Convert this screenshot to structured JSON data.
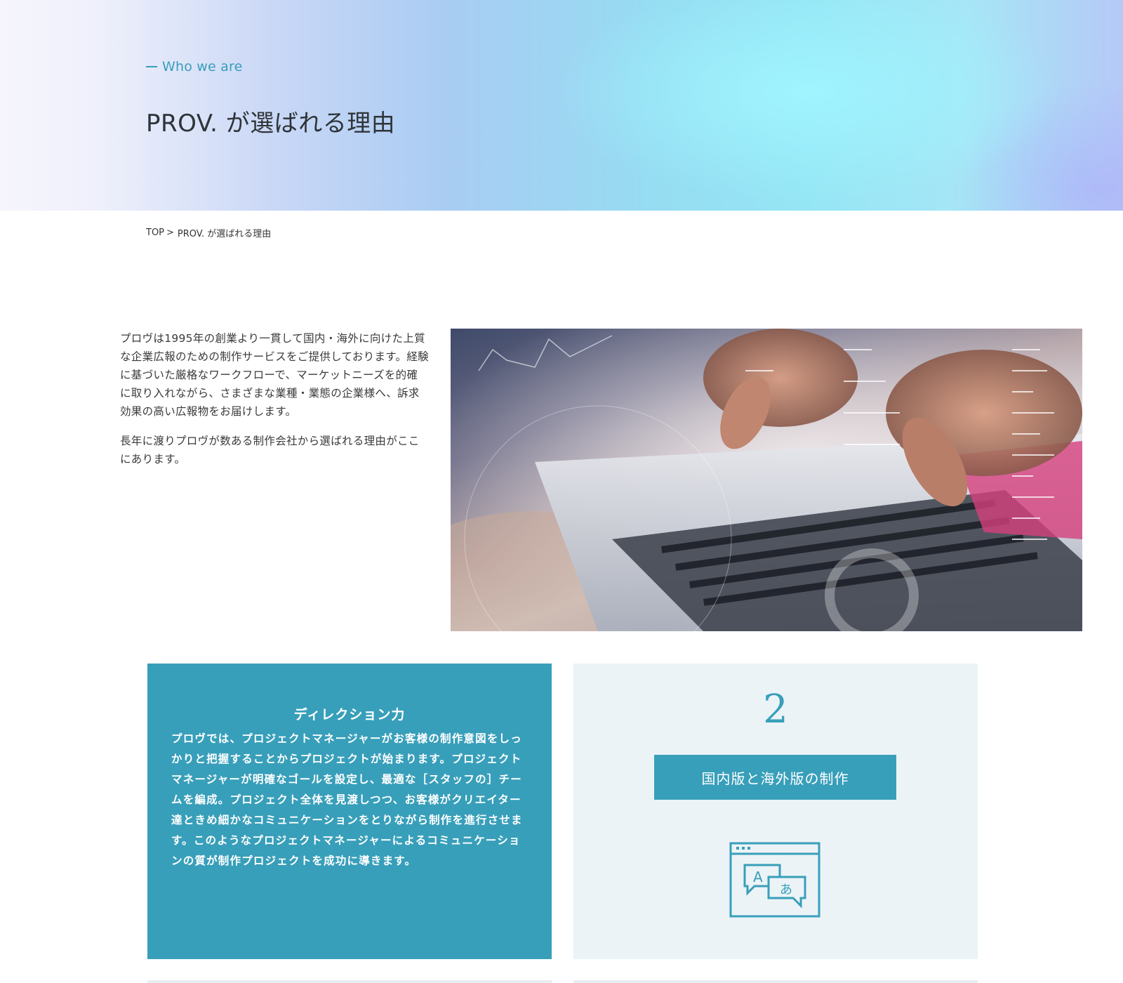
{
  "hero": {
    "eyebrow": "Who we are",
    "title": "PROV. が選ばれる理由"
  },
  "breadcrumb": {
    "home": "TOP",
    "separator": ">",
    "current": "PROV. が選ばれる理由"
  },
  "intro": {
    "paragraph1": "プロヴは1995年の創業より一貫して国内・海外に向けた上質な企業広報のための制作サービスをご提供しております。経験に基づいた厳格なワークフローで、マーケットニーズを的確に取り入れながら、さまざまな業種・業態の企業様へ、訴求効果の高い広報物をお届けします。",
    "paragraph2": "長年に渡りプロヴが数ある制作会社から選ばれる理由がここにあります。"
  },
  "cards": [
    {
      "title": "ディレクション力",
      "text": "プロヴでは、プロジェクトマネージャーがお客様の制作意図をしっかりと把握することからプロジェクトが始まります。プロジェクトマネージャーが明確なゴールを設定し、最適な［スタッフの］チームを編成。プロジェクト全体を見渡しつつ、お客様がクリエイター達ときめ細かなコミュニケーションをとりながら制作を進行させます。このようなプロジェクトマネージャーによるコミュニケーションの質が制作プロジェクトを成功に導きます。"
    },
    {
      "number": "2",
      "label": "国内版と海外版の制作",
      "icon": "translation-icon",
      "icon_letters": [
        "A",
        "あ"
      ]
    }
  ],
  "colors": {
    "accent": "#389fba",
    "card_light": "#ecf3f7",
    "text": "#333333"
  }
}
